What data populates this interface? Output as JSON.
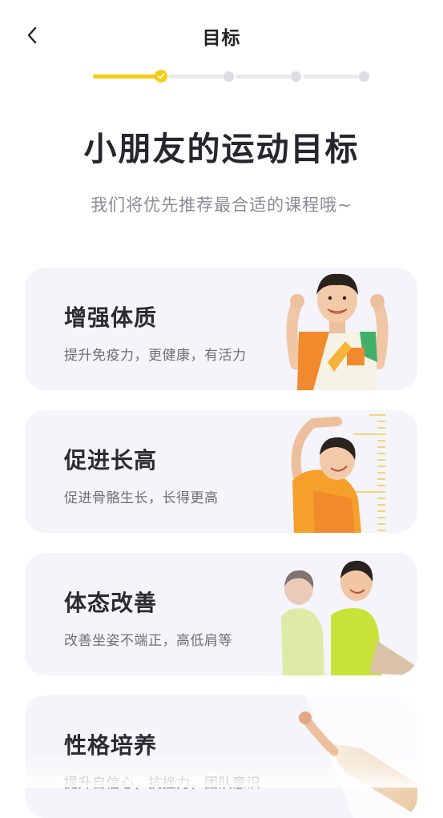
{
  "header": {
    "title": "目标",
    "back_icon": "chevron-left-icon"
  },
  "progress": {
    "total_steps": 4,
    "current_step": 1,
    "accent": "#f5cc13"
  },
  "main": {
    "heading": "小朋友的运动目标",
    "subheading": "我们将优先推荐最合适的课程哦~"
  },
  "goals": [
    {
      "title": "增强体质",
      "desc": "提升免疫力，更健康，有活力",
      "image": "boy-flexing-arms"
    },
    {
      "title": "促进长高",
      "desc": "促进骨骼生长，长得更高",
      "image": "boy-measuring-height"
    },
    {
      "title": "体态改善",
      "desc": "改善坐姿不端正，高低肩等",
      "image": "boys-sitting-posture"
    },
    {
      "title": "性格培养",
      "desc": "提升自信心，抗挫力，团队意识",
      "image": "child-raising-arm"
    }
  ]
}
